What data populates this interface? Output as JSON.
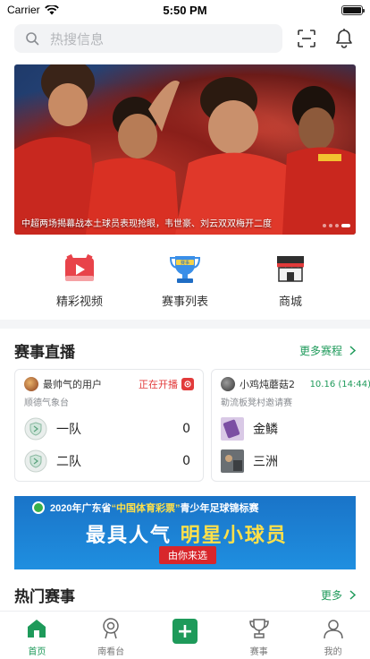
{
  "status_bar": {
    "carrier": "Carrier",
    "time": "5:50 PM"
  },
  "search": {
    "placeholder": "热搜信息"
  },
  "banner": {
    "caption": "中超两场揭幕战本土球员表现抢眼，韦世豪、刘云双双梅开二度"
  },
  "quick_nav": [
    {
      "label": "精彩视频",
      "icon": "video-icon"
    },
    {
      "label": "赛事列表",
      "icon": "trophy-icon",
      "badge": "赛事"
    },
    {
      "label": "商城",
      "icon": "shop-icon"
    }
  ],
  "live": {
    "title": "赛事直播",
    "more": "更多赛程",
    "cards": [
      {
        "user": "最帅气的用户",
        "status": "正在开播",
        "venue": "顺德气象台",
        "teams": [
          {
            "name": "一队",
            "score": "0"
          },
          {
            "name": "二队",
            "score": "0"
          }
        ]
      },
      {
        "user": "小鸡炖蘑菇2",
        "time": "10.16 (14:44)",
        "venue": "勒流板凳村邀请赛",
        "teams": [
          {
            "name": "金鳞"
          },
          {
            "name": "三洲"
          }
        ]
      }
    ]
  },
  "ad": {
    "top_prefix": "2020年广东省",
    "top_highlight": "“中国体育彩票”",
    "top_suffix": "青少年足球锦标赛",
    "main_left": "最具人气",
    "main_right": "明星小球员",
    "sub": "由你来选"
  },
  "hot": {
    "title": "热门赛事",
    "more": "更多"
  },
  "tab_bar": {
    "items": [
      {
        "label": "首页",
        "icon": "home-icon",
        "active": true
      },
      {
        "label": "南看台",
        "icon": "stand-icon"
      },
      {
        "label": "",
        "icon": "plus-icon"
      },
      {
        "label": "赛事",
        "icon": "trophy-tab-icon"
      },
      {
        "label": "我的",
        "icon": "profile-icon"
      }
    ]
  },
  "colors": {
    "accent": "#1e9a5a",
    "live_red": "#e23b3b"
  }
}
